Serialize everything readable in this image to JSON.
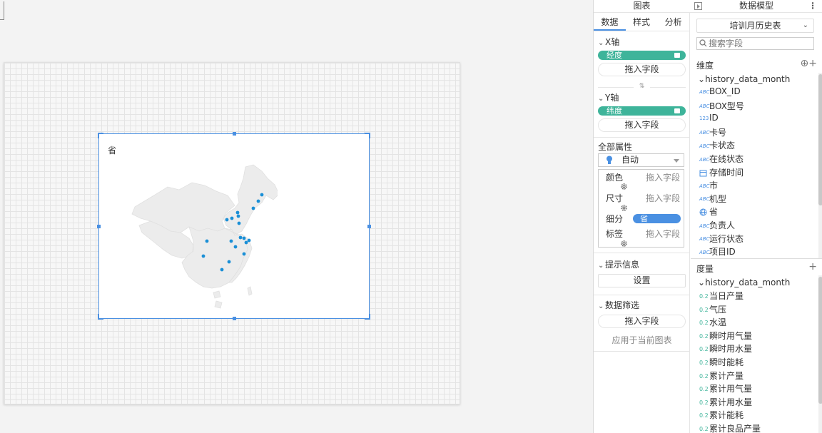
{
  "panel_header": {
    "chart_tab_label": "图表",
    "data_model_label": "数据模型",
    "more_label": "⋮"
  },
  "tabs": [
    "数据",
    "样式",
    "分析"
  ],
  "x_axis": {
    "title": "X轴",
    "field": "经度",
    "drop_label": "拖入字段"
  },
  "y_axis": {
    "title": "Y轴",
    "field": "纬度",
    "drop_label": "拖入字段"
  },
  "all_props": {
    "title": "全部属性",
    "mode": "自动",
    "color_label": "颜色",
    "size_label": "尺寸",
    "detail_label": "细分",
    "detail_field": "省",
    "label_label": "标签",
    "drop_label": "拖入字段"
  },
  "tooltip": {
    "title": "提示信息",
    "button": "设置"
  },
  "filter": {
    "title": "数据筛选",
    "drop_label": "拖入字段",
    "apply_label": "应用于当前图表"
  },
  "data_model": {
    "table_name": "培训月历史表",
    "search_placeholder": "搜索字段",
    "dimension_title": "维度",
    "measure_title": "度量",
    "dimension_group": "history_data_month",
    "measure_group": "history_data_month",
    "dimensions": [
      {
        "icon": "ABC",
        "label": "BOX_ID"
      },
      {
        "icon": "ABC",
        "label": "BOX型号"
      },
      {
        "icon": "123",
        "label": "ID"
      },
      {
        "icon": "ABC",
        "label": "卡号"
      },
      {
        "icon": "ABC",
        "label": "卡状态"
      },
      {
        "icon": "ABC",
        "label": "在线状态"
      },
      {
        "icon": "date",
        "label": "存储时间"
      },
      {
        "icon": "ABC",
        "label": "市"
      },
      {
        "icon": "ABC",
        "label": "机型"
      },
      {
        "icon": "geo",
        "label": "省"
      },
      {
        "icon": "ABC",
        "label": "负责人"
      },
      {
        "icon": "ABC",
        "label": "运行状态"
      },
      {
        "icon": "ABC",
        "label": "项目ID"
      }
    ],
    "measures": [
      {
        "icon": "0.2",
        "label": "当日产量"
      },
      {
        "icon": "0.2",
        "label": "气压"
      },
      {
        "icon": "0.2",
        "label": "水温"
      },
      {
        "icon": "0.2",
        "label": "瞬时用气量"
      },
      {
        "icon": "0.2",
        "label": "瞬时用水量"
      },
      {
        "icon": "0.2",
        "label": "瞬时能耗"
      },
      {
        "icon": "0.2",
        "label": "累计产量"
      },
      {
        "icon": "0.2",
        "label": "累计用气量"
      },
      {
        "icon": "0.2",
        "label": "累计用水量"
      },
      {
        "icon": "0.2",
        "label": "累计能耗"
      },
      {
        "icon": "0.2",
        "label": "累计良品产量"
      }
    ]
  },
  "widget": {
    "title": "省"
  },
  "colors": {
    "accent": "#4a90e2",
    "pill_green": "#3eb49a",
    "map_fill": "#ececec",
    "point": "#1a8fd6"
  }
}
